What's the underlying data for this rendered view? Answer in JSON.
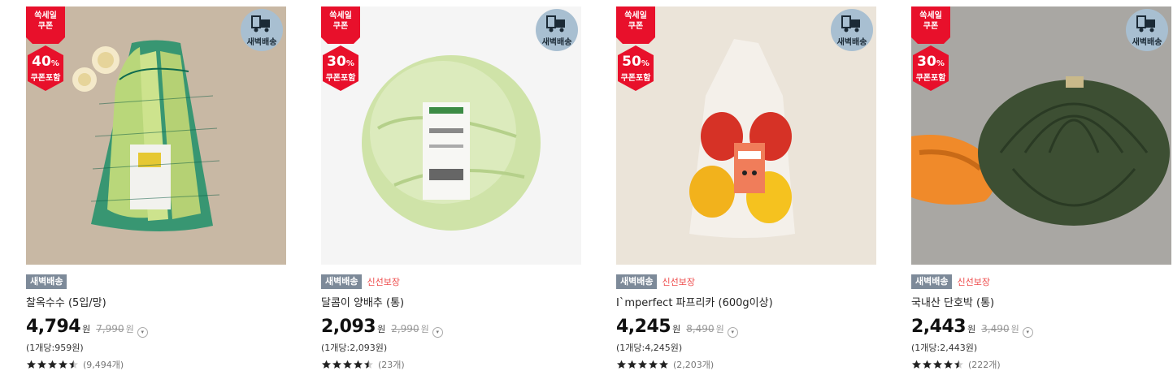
{
  "labels": {
    "event_line1": "쏙세일",
    "event_line2": "쿠폰",
    "coupon_included": "쿠폰포함",
    "dawn_delivery": "새벽배송",
    "tag_dawn": "새벽배송",
    "tag_fresh": "신선보장",
    "won": "원",
    "percent": "%",
    "info_icon": "info-circle-icon",
    "truck_icon": "delivery-truck-icon",
    "star_icon": "star-icon"
  },
  "colors": {
    "event_red": "#e8102b",
    "dawn_badge": "#a8bfd1",
    "tag_dawn": "#7d8a99",
    "tag_fresh": "#ee4b4b"
  },
  "products": [
    {
      "discount": "40",
      "fresh_tag": "",
      "name": "찰옥수수 (5입/망)",
      "price": "4,794",
      "original_price": "7,990",
      "unit_price": "(1개당:959원)",
      "rating": 4.5,
      "reviews": "(9,494개)"
    },
    {
      "discount": "30",
      "fresh_tag": "신선보장",
      "name": "달콤이 양배추 (통)",
      "price": "2,093",
      "original_price": "2,990",
      "unit_price": "(1개당:2,093원)",
      "rating": 4.5,
      "reviews": "(23개)"
    },
    {
      "discount": "50",
      "fresh_tag": "신선보장",
      "name": "I`mperfect 파프리카 (600g이상)",
      "price": "4,245",
      "original_price": "8,490",
      "unit_price": "(1개당:4,245원)",
      "rating": 5,
      "reviews": "(2,203개)"
    },
    {
      "discount": "30",
      "fresh_tag": "신선보장",
      "name": "국내산 단호박 (통)",
      "price": "2,443",
      "original_price": "3,490",
      "unit_price": "(1개당:2,443원)",
      "rating": 4.5,
      "reviews": "(222개)"
    }
  ]
}
